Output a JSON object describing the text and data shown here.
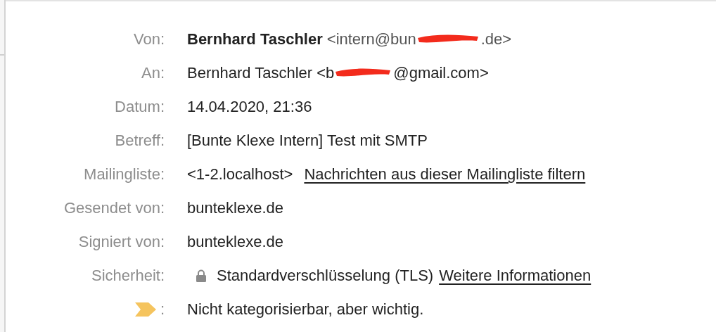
{
  "headers": [
    {
      "kind": "from",
      "label": "Von:",
      "name": "Bernhard Taschler",
      "address_start": "<intern@bun",
      "address_end": ".de>"
    },
    {
      "kind": "to",
      "label": "An:",
      "value_start": "Bernhard Taschler <b",
      "value_end": "@gmail.com>"
    },
    {
      "kind": "text",
      "label": "Datum:",
      "value": "14.04.2020, 21:36"
    },
    {
      "kind": "text",
      "label": "Betreff:",
      "value": "[Bunte Klexe Intern] Test mit SMTP"
    },
    {
      "kind": "list",
      "label": "Mailingliste:",
      "value": "<1-2.localhost>",
      "link": "Nachrichten aus dieser Mailingliste filtern"
    },
    {
      "kind": "text",
      "label": "Gesendet von:",
      "value": "bunteklexe.de"
    },
    {
      "kind": "text",
      "label": "Signiert von:",
      "value": "bunteklexe.de"
    },
    {
      "kind": "security",
      "label": "Sicherheit:",
      "value": "Standardverschlüsselung (TLS)",
      "link": "Weitere Informationen"
    },
    {
      "kind": "tag",
      "color": "#f5c45e",
      "label": ":",
      "value": "Nicht kategorisierbar, aber wichtig."
    }
  ]
}
